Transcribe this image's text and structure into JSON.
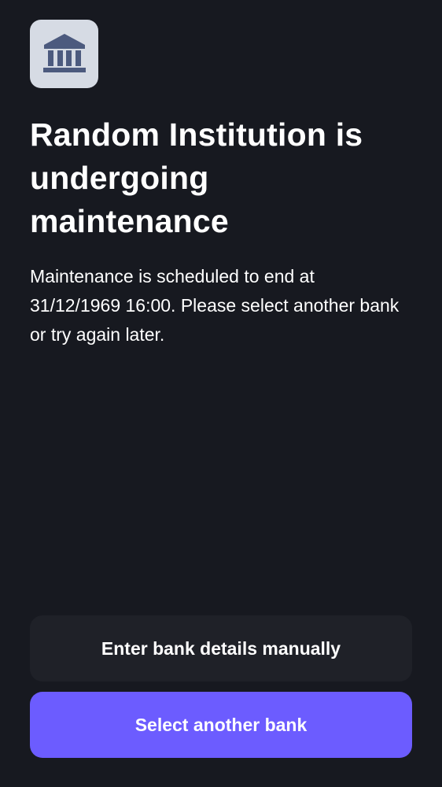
{
  "bank": {
    "icon": "bank-building-icon",
    "icon_bg_color": "#d6dbe4",
    "icon_color": "#4c5a7e"
  },
  "heading": "Random Institution is undergoing maintenance",
  "message": "Maintenance is scheduled to end at 31/12/1969 16:00. Please select another bank or try again later.",
  "actions": {
    "manual_label": "Enter bank details manually",
    "select_bank_label": "Select another bank"
  },
  "colors": {
    "background": "#171920",
    "primary": "#6c5cff",
    "secondary": "#1f2128"
  }
}
